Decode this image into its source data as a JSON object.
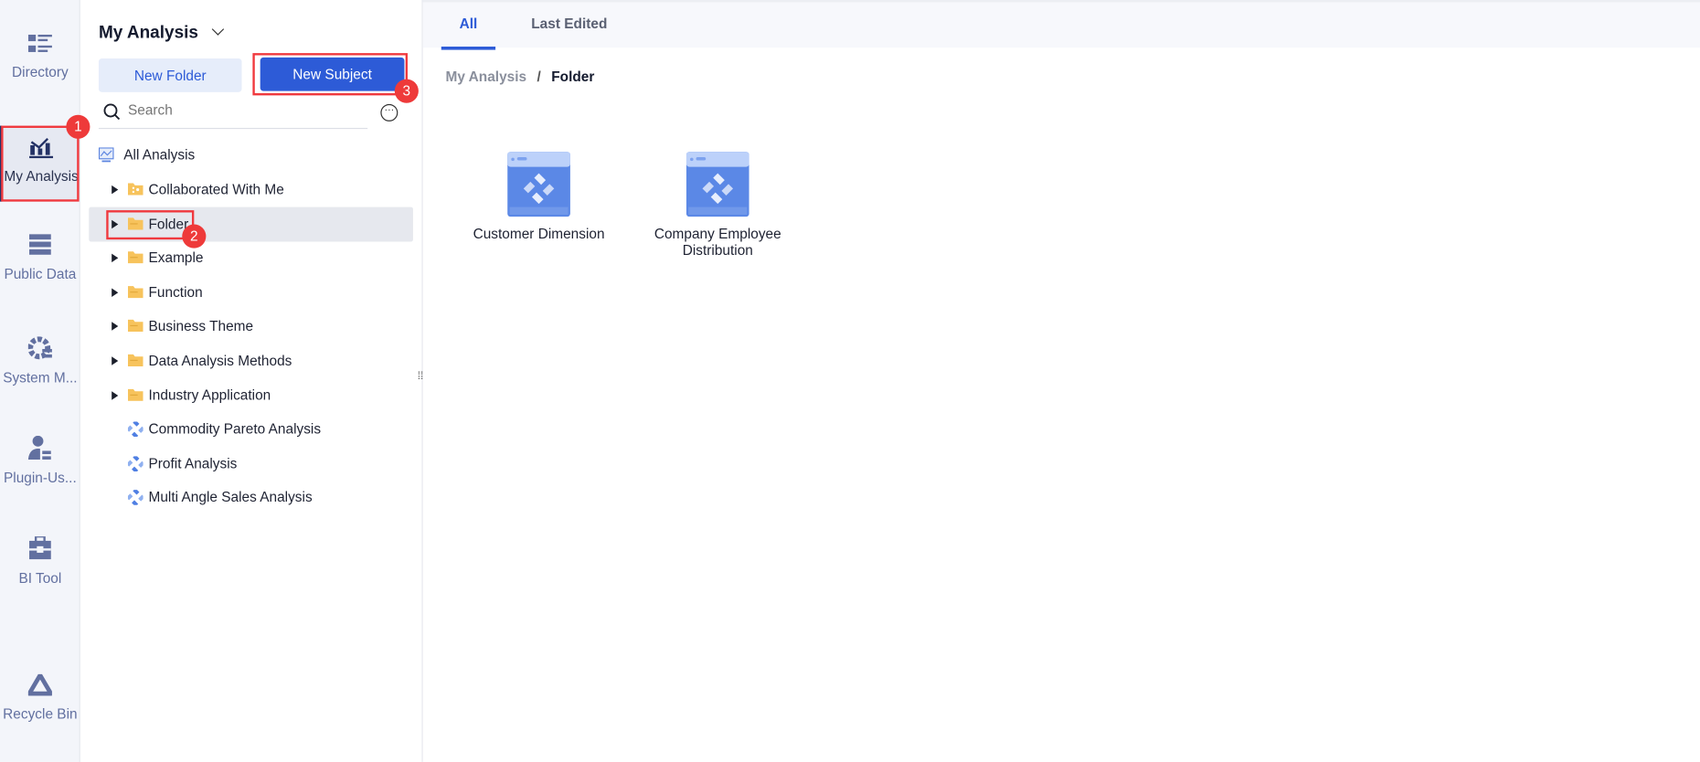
{
  "rail": [
    {
      "label": "Directory",
      "icon": "directory-icon"
    },
    {
      "label": "My Analysis",
      "icon": "analysis-chart-icon"
    },
    {
      "label": "Public Data",
      "icon": "public-data-icon"
    },
    {
      "label": "System M...",
      "icon": "system-gear-icon"
    },
    {
      "label": "Plugin-Us...",
      "icon": "plugin-user-icon"
    },
    {
      "label": "BI Tool",
      "icon": "toolbox-icon"
    },
    {
      "label": "Recycle Bin",
      "icon": "recycle-icon"
    }
  ],
  "tree": {
    "title": "My Analysis",
    "new_folder": "New Folder",
    "new_subject": "New Subject",
    "search_placeholder": "Search",
    "root": "All Analysis",
    "items": [
      {
        "label": "Collaborated With Me",
        "type": "shared-folder"
      },
      {
        "label": "Folder",
        "type": "folder"
      },
      {
        "label": "Example",
        "type": "folder"
      },
      {
        "label": "Function",
        "type": "folder"
      },
      {
        "label": "Business Theme",
        "type": "folder"
      },
      {
        "label": "Data Analysis Methods",
        "type": "folder"
      },
      {
        "label": "Industry Application",
        "type": "folder"
      },
      {
        "label": "Commodity Pareto Analysis",
        "type": "subject"
      },
      {
        "label": "Profit Analysis",
        "type": "subject"
      },
      {
        "label": "Multi Angle Sales Analysis",
        "type": "subject"
      }
    ]
  },
  "main": {
    "tabs": [
      "All",
      "Last Edited"
    ],
    "breadcrumb": [
      "My Analysis",
      "Folder"
    ],
    "breadcrumb_sep": "/",
    "cards": [
      "Customer Dimension",
      "Company Employee Distribution"
    ]
  },
  "annotations": [
    "1",
    "2",
    "3"
  ],
  "colors": {
    "accent": "#2d5bd7",
    "highlight": "#f0393e",
    "folder": "#f7c35c"
  }
}
